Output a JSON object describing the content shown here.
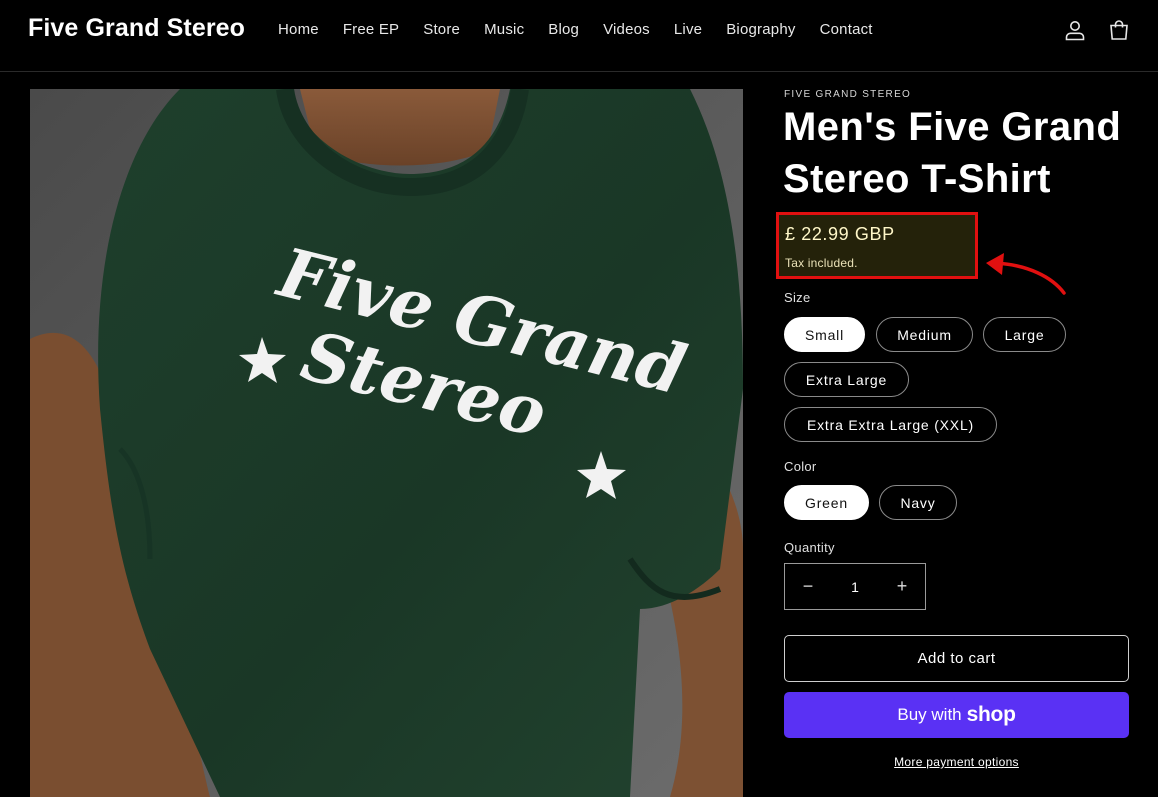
{
  "brand": "Five Grand Stereo",
  "nav": [
    "Home",
    "Free EP",
    "Store",
    "Music",
    "Blog",
    "Videos",
    "Live",
    "Biography",
    "Contact"
  ],
  "header_icons": [
    "account-icon",
    "cart-icon"
  ],
  "product": {
    "vendor": "FIVE GRAND STEREO",
    "title": "Men's Five Grand Stereo T-Shirt",
    "price": "£ 22.99 GBP",
    "tax_note": "Tax included.",
    "image_print": [
      "Five Grand",
      "Stereo"
    ]
  },
  "size": {
    "label": "Size",
    "options": [
      "Small",
      "Medium",
      "Large",
      "Extra Large",
      "Extra Extra Large (XXL)"
    ],
    "selected": "Small"
  },
  "color": {
    "label": "Color",
    "options": [
      "Green",
      "Navy"
    ],
    "selected": "Green"
  },
  "quantity": {
    "label": "Quantity",
    "value": "1",
    "decrease": "−",
    "increase": "+"
  },
  "buttons": {
    "add_to_cart": "Add to cart",
    "buy_with": "Buy with",
    "shop_word": "shop",
    "more_payment": "More payment options"
  },
  "colors": {
    "highlight_border": "#e11010",
    "shop_pay": "#5a31f4",
    "shirt": "#1d3b2a"
  }
}
